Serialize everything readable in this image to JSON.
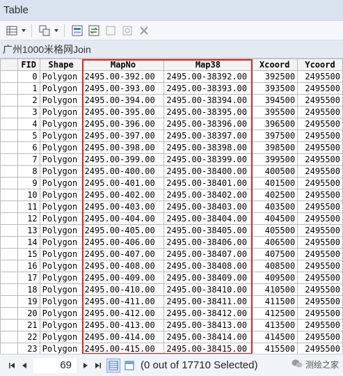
{
  "window": {
    "title": "Table"
  },
  "toolbar": {
    "icons": [
      "table-options-icon",
      "related-tables-icon",
      "select-by-attributes-icon",
      "switch-selection-icon",
      "clear-selection-icon",
      "zoom-to-selected-icon",
      "delete-selected-icon"
    ]
  },
  "tab": {
    "label": "广州1000米格网Join"
  },
  "table": {
    "columns": [
      "FID",
      "Shape",
      "MapNo",
      "Map38",
      "Xcoord",
      "Ycoord"
    ],
    "rows": [
      [
        "0",
        "Polygon",
        "2495.00-392.00",
        "2495.00-38392.00",
        "392500",
        "2495500"
      ],
      [
        "1",
        "Polygon",
        "2495.00-393.00",
        "2495.00-38393.00",
        "393500",
        "2495500"
      ],
      [
        "2",
        "Polygon",
        "2495.00-394.00",
        "2495.00-38394.00",
        "394500",
        "2495500"
      ],
      [
        "3",
        "Polygon",
        "2495.00-395.00",
        "2495.00-38395.00",
        "395500",
        "2495500"
      ],
      [
        "4",
        "Polygon",
        "2495.00-396.00",
        "2495.00-38396.00",
        "396500",
        "2495500"
      ],
      [
        "5",
        "Polygon",
        "2495.00-397.00",
        "2495.00-38397.00",
        "397500",
        "2495500"
      ],
      [
        "6",
        "Polygon",
        "2495.00-398.00",
        "2495.00-38398.00",
        "398500",
        "2495500"
      ],
      [
        "7",
        "Polygon",
        "2495.00-399.00",
        "2495.00-38399.00",
        "399500",
        "2495500"
      ],
      [
        "8",
        "Polygon",
        "2495.00-400.00",
        "2495.00-38400.00",
        "400500",
        "2495500"
      ],
      [
        "9",
        "Polygon",
        "2495.00-401.00",
        "2495.00-38401.00",
        "401500",
        "2495500"
      ],
      [
        "10",
        "Polygon",
        "2495.00-402.00",
        "2495.00-38402.00",
        "402500",
        "2495500"
      ],
      [
        "11",
        "Polygon",
        "2495.00-403.00",
        "2495.00-38403.00",
        "403500",
        "2495500"
      ],
      [
        "12",
        "Polygon",
        "2495.00-404.00",
        "2495.00-38404.00",
        "404500",
        "2495500"
      ],
      [
        "13",
        "Polygon",
        "2495.00-405.00",
        "2495.00-38405.00",
        "405500",
        "2495500"
      ],
      [
        "14",
        "Polygon",
        "2495.00-406.00",
        "2495.00-38406.00",
        "406500",
        "2495500"
      ],
      [
        "15",
        "Polygon",
        "2495.00-407.00",
        "2495.00-38407.00",
        "407500",
        "2495500"
      ],
      [
        "16",
        "Polygon",
        "2495.00-408.00",
        "2495.00-38408.00",
        "408500",
        "2495500"
      ],
      [
        "17",
        "Polygon",
        "2495.00-409.00",
        "2495.00-38409.00",
        "409500",
        "2495500"
      ],
      [
        "18",
        "Polygon",
        "2495.00-410.00",
        "2495.00-38410.00",
        "410500",
        "2495500"
      ],
      [
        "19",
        "Polygon",
        "2495.00-411.00",
        "2495.00-38411.00",
        "411500",
        "2495500"
      ],
      [
        "20",
        "Polygon",
        "2495.00-412.00",
        "2495.00-38412.00",
        "412500",
        "2495500"
      ],
      [
        "21",
        "Polygon",
        "2495.00-413.00",
        "2495.00-38413.00",
        "413500",
        "2495500"
      ],
      [
        "22",
        "Polygon",
        "2495.00-414.00",
        "2495.00-38414.00",
        "414500",
        "2495500"
      ],
      [
        "23",
        "Polygon",
        "2495.00-415.00",
        "2495.00-38415.00",
        "415500",
        "2495500"
      ]
    ]
  },
  "highlight": {
    "color": "#e02020"
  },
  "status": {
    "current_record": "69",
    "selection_text": "(0 out of 17710 Selected)"
  },
  "watermark": {
    "text": "测绘之家"
  }
}
